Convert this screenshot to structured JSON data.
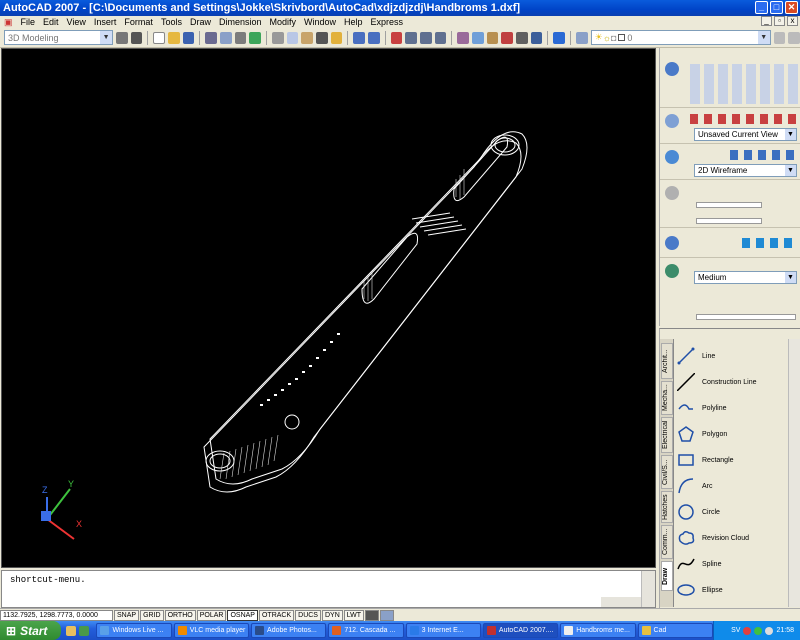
{
  "window": {
    "title": "AutoCAD 2007 - [C:\\Documents and Settings\\Jokke\\Skrivbord\\AutoCad\\xdjzdjzdj\\Handbroms 1.dxf]"
  },
  "menu": [
    "File",
    "Edit",
    "View",
    "Insert",
    "Format",
    "Tools",
    "Draw",
    "Dimension",
    "Modify",
    "Window",
    "Help",
    "Express"
  ],
  "toolbar": {
    "workspace": "3D Modeling",
    "layer": "0"
  },
  "command": {
    "text": "shortcut-menu."
  },
  "dashboard": {
    "view": "Unsaved Current View",
    "visual_style": "2D Wireframe",
    "light_quality": "Medium"
  },
  "palette": {
    "tabs": [
      "Archit...",
      "Mecha...",
      "Electrical",
      "Civil/S...",
      "Hatches",
      "Comm...",
      "Draw"
    ],
    "active_tab": "Draw",
    "items": [
      "Line",
      "Construction Line",
      "Polyline",
      "Polygon",
      "Rectangle",
      "Arc",
      "Circle",
      "Revision Cloud",
      "Spline",
      "Ellipse"
    ]
  },
  "ucs": {
    "x": "X",
    "y": "Y",
    "z": "Z"
  },
  "status": {
    "coords": "1132.7925, 1298.7773, 0.0000",
    "buttons": [
      "SNAP",
      "GRID",
      "ORTHO",
      "POLAR",
      "OSNAP",
      "OTRACK",
      "DUCS",
      "DYN",
      "LWT"
    ],
    "on": [
      "OSNAP"
    ]
  },
  "taskbar": {
    "start": "Start",
    "tasks": [
      "Windows Live ...",
      "VLC media player",
      "Adobe Photos...",
      "712. Cascada ...",
      "3 Internet E...",
      "AutoCAD 2007....",
      "Handbroms me...",
      "Cad"
    ],
    "active": "AutoCAD 2007....",
    "lang": "SV",
    "time": "21:58"
  },
  "colors": {
    "title": "#0a50d8",
    "canvas": "#000000",
    "taskbar": "#245edb",
    "start": "#3a9a3a"
  }
}
